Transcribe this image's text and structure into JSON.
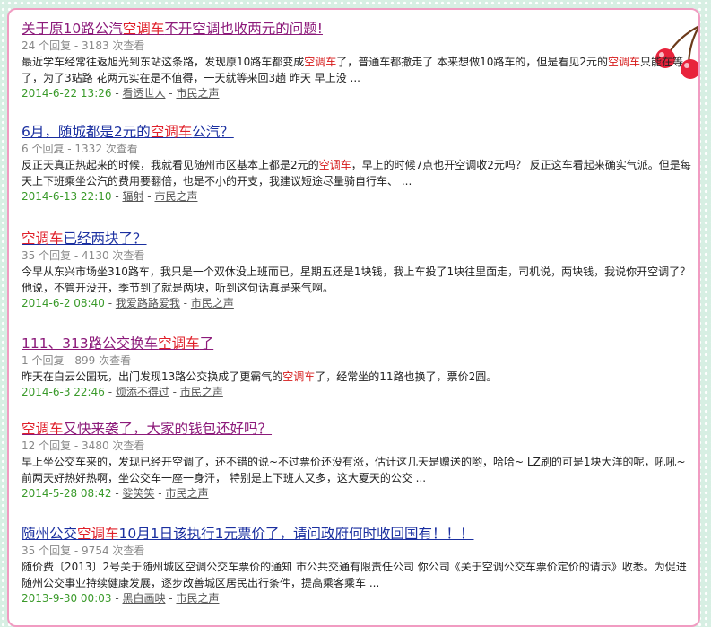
{
  "colors": {
    "title_link": "#1a2fa0",
    "title_visited": "#8c1a7a",
    "keyword": "#e0202a",
    "date": "#3a9a2a",
    "panel_border": "#f19cc2"
  },
  "decor": {
    "corner_icon": "cherry-icon"
  },
  "results": [
    {
      "visited": true,
      "title_parts": [
        "关于原10路公汽",
        "空调车",
        "不开空调也收两元的问题!"
      ],
      "meta": "24 个回复 - 3183 次查看",
      "snippet_parts": [
        "最近学车经常往返旭光到东站这条路，发现原10路车都变成",
        "空调车",
        "了，普通车都撤走了 本来想做10路车的，但是看见2元的",
        "空调车",
        "只能在等了，为了3站路 花两元实在是不值得，一天就等来回3趟 昨天 早上没 ..."
      ],
      "date": "2014-6-22 13:26",
      "author": "看透世人",
      "board": "市民之声"
    },
    {
      "visited": false,
      "title_parts": [
        "6月，随城都是2元的",
        "空调车",
        "公汽？"
      ],
      "meta": "6 个回复 - 1332 次查看",
      "snippet_parts": [
        "反正天真正热起来的时候，我就看见随州市区基本上都是2元的",
        "空调车",
        "，早上的时候7点也开空调收2元吗？ 反正这车看起来确实气派。但是每天上下班乘坐公汽的费用要翻倍，也是不小的开支，我建议短途尽量骑自行车、 ..."
      ],
      "date": "2014-6-13 22:10",
      "author": "辐射",
      "board": "市民之声"
    },
    {
      "visited": false,
      "title_parts": [
        "",
        "空调车",
        "已经两块了？"
      ],
      "meta": "35 个回复 - 4130 次查看",
      "snippet_parts": [
        "今早从东兴市场坐310路车，我只是一个双休没上班而已，星期五还是1块钱，我上车投了1块往里面走，司机说，两块钱，我说你开空调了？他说，不管开没开，季节到了就是两块，听到这句话真是来气啊。"
      ],
      "date": "2014-6-2 08:40",
      "author": "我爱路路爱我",
      "board": "市民之声"
    },
    {
      "visited": true,
      "title_parts": [
        "111、313路公交换车",
        "空调车",
        "了"
      ],
      "meta": "1 个回复 - 899 次查看",
      "snippet_parts": [
        "昨天在白云公园玩，出门发现13路公交换成了更霸气的",
        "空调车",
        "了，经常坐的11路也换了，票价2圆。"
      ],
      "date": "2014-6-3 22:46",
      "author": "烦添不得过",
      "board": "市民之声"
    },
    {
      "visited": true,
      "title_parts": [
        "",
        "空调车",
        "又快来袭了，大家的钱包还好吗？"
      ],
      "meta": "12 个回复 - 3480 次查看",
      "snippet_parts": [
        "早上坐公交车来的，发现已经开空调了，还不错的说~不过票价还没有涨，估计这几天是赠送的哟，哈哈~ LZ刷的可是1块大洋的呢，吼吼~ 前两天好热好热啊，坐公交车一座一身汗， 特别是上下班人又多，这大夏天的公交 ..."
      ],
      "date": "2014-5-28 08:42",
      "author": "娑笑笑",
      "board": "市民之声"
    },
    {
      "visited": false,
      "title_parts": [
        "随州公交",
        "空调车",
        "10月1日该执行1元票价了，请问政府何时收回国有！！！"
      ],
      "meta": "35 个回复 - 9754 次查看",
      "snippet_parts": [
        "随价费〔2013〕2号关于随州城区空调公交车票价的通知 市公共交通有限责任公司 你公司《关于空调公交车票价定价的请示》收悉。为促进随州公交事业持续健康发展，逐步改善城区居民出行条件，提高乘客乘车 ..."
      ],
      "date": "2013-9-30 00:03",
      "author": "黑白画映",
      "board": "市民之声"
    }
  ]
}
